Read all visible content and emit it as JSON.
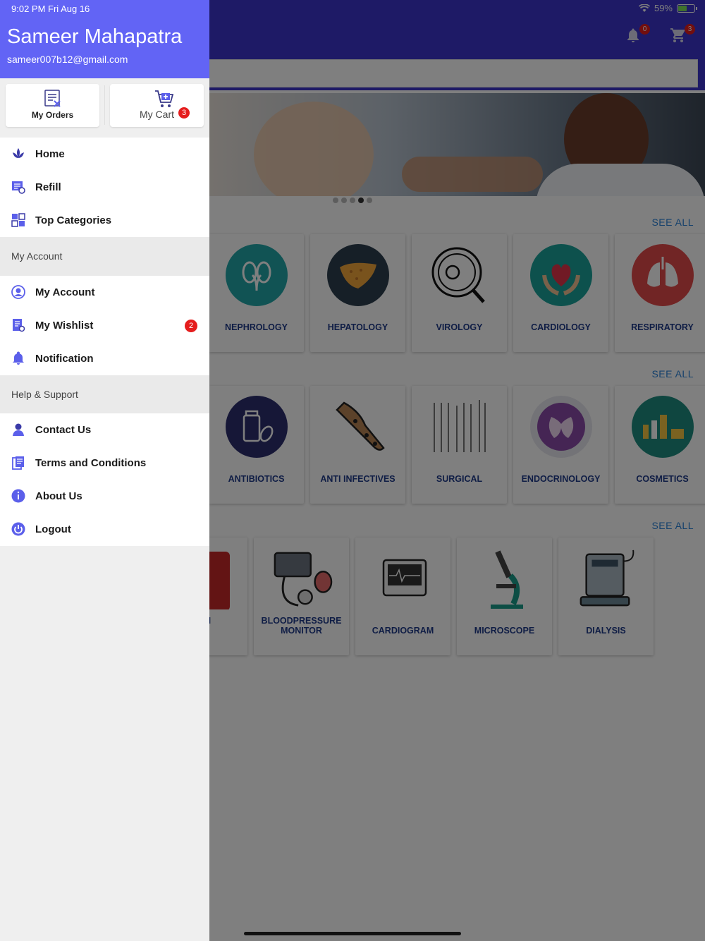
{
  "status_bar": {
    "time": "9:02 PM   Fri Aug 16",
    "battery": "59%",
    "battery_level": 0.59
  },
  "drawer": {
    "user_name": "Sameer Mahapatra",
    "user_email": "sameer007b12@gmail.com",
    "quick_actions": {
      "orders_label": "My Orders",
      "cart_label": "My Cart",
      "cart_badge": "3"
    },
    "main_menu": [
      {
        "label": "Home",
        "icon": "lotus-icon"
      },
      {
        "label": "Refill",
        "icon": "refill-icon"
      },
      {
        "label": "Top Categories",
        "icon": "grid-icon"
      }
    ],
    "section_account": "My Account",
    "account_menu": [
      {
        "label": "My Account",
        "icon": "user-icon"
      },
      {
        "label": "My Wishlist",
        "icon": "wishlist-icon",
        "badge": "2"
      },
      {
        "label": "Notification",
        "icon": "bell-icon"
      }
    ],
    "section_help": "Help & Support",
    "help_menu": [
      {
        "label": "Contact Us",
        "icon": "contact-icon"
      },
      {
        "label": "Terms and Conditions",
        "icon": "document-icon"
      },
      {
        "label": "About Us",
        "icon": "info-icon"
      },
      {
        "label": "Logout",
        "icon": "power-icon"
      }
    ]
  },
  "app": {
    "bell_badge": "0",
    "cart_badge": "3",
    "see_all": "SEE ALL",
    "row1": [
      "NEPHROLOGY",
      "HEPATOLOGY",
      "VIROLOGY",
      "CARDIOLOGY",
      "RESPIRATORY"
    ],
    "row2": [
      "ANTIBIOTICS",
      "ANTI INFECTIVES",
      "SURGICAL",
      "ENDOCRINOLOGY",
      "COSMETICS"
    ],
    "row3": [
      "OBIN\nOR",
      "BLOODPRESSURE MONITOR",
      "CARDIOGRAM",
      "MICROSCOPE",
      "DIALYSIS"
    ]
  },
  "colors": {
    "drawer_header": "#6264f5",
    "app_bar": "#3c34cc",
    "badge": "#e51d1d",
    "label": "#1f3a8a",
    "see_all": "#2a82d9"
  }
}
